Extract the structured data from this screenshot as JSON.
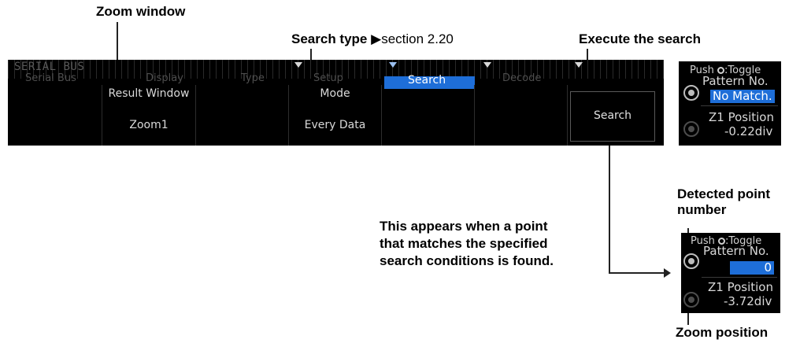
{
  "callouts": {
    "zoom_window": "Zoom window",
    "search_type": "Search type",
    "search_type_ref": "section 2.20",
    "execute_search": "Execute the search",
    "detected_point_number": [
      "Detected point",
      "number"
    ],
    "appears_note": [
      "This appears when a point",
      "that matches the specified",
      "search conditions is found."
    ],
    "zoom_position": "Zoom position"
  },
  "menu": {
    "title": "SERIAL BUS",
    "tabs": [
      "Serial Bus",
      "Display",
      "Type",
      "Setup",
      "Search",
      "Decode"
    ],
    "active_tab": "Search"
  },
  "softkeys": {
    "result_window_label": "Result Window",
    "result_window_value": "Zoom1",
    "mode_label": "Mode",
    "mode_value": "Every Data",
    "search_button": "Search"
  },
  "panel_top": {
    "push_label": "Push",
    "toggle_label": ":Toggle",
    "pattern_label": "Pattern No.",
    "pattern_value": "No Match.",
    "z1_label": "Z1 Position",
    "z1_value": "-0.22div"
  },
  "panel_bottom": {
    "push_label": "Push",
    "toggle_label": ":Toggle",
    "pattern_label": "Pattern No.",
    "pattern_value": "0",
    "z1_label": "Z1 Position",
    "z1_value": "-3.72div"
  },
  "colors": {
    "highlight": "#1e6ed8",
    "screen_bg": "#000000"
  },
  "icons": {
    "arrow_right": "▶",
    "knob": "rotary-knob-icon"
  }
}
